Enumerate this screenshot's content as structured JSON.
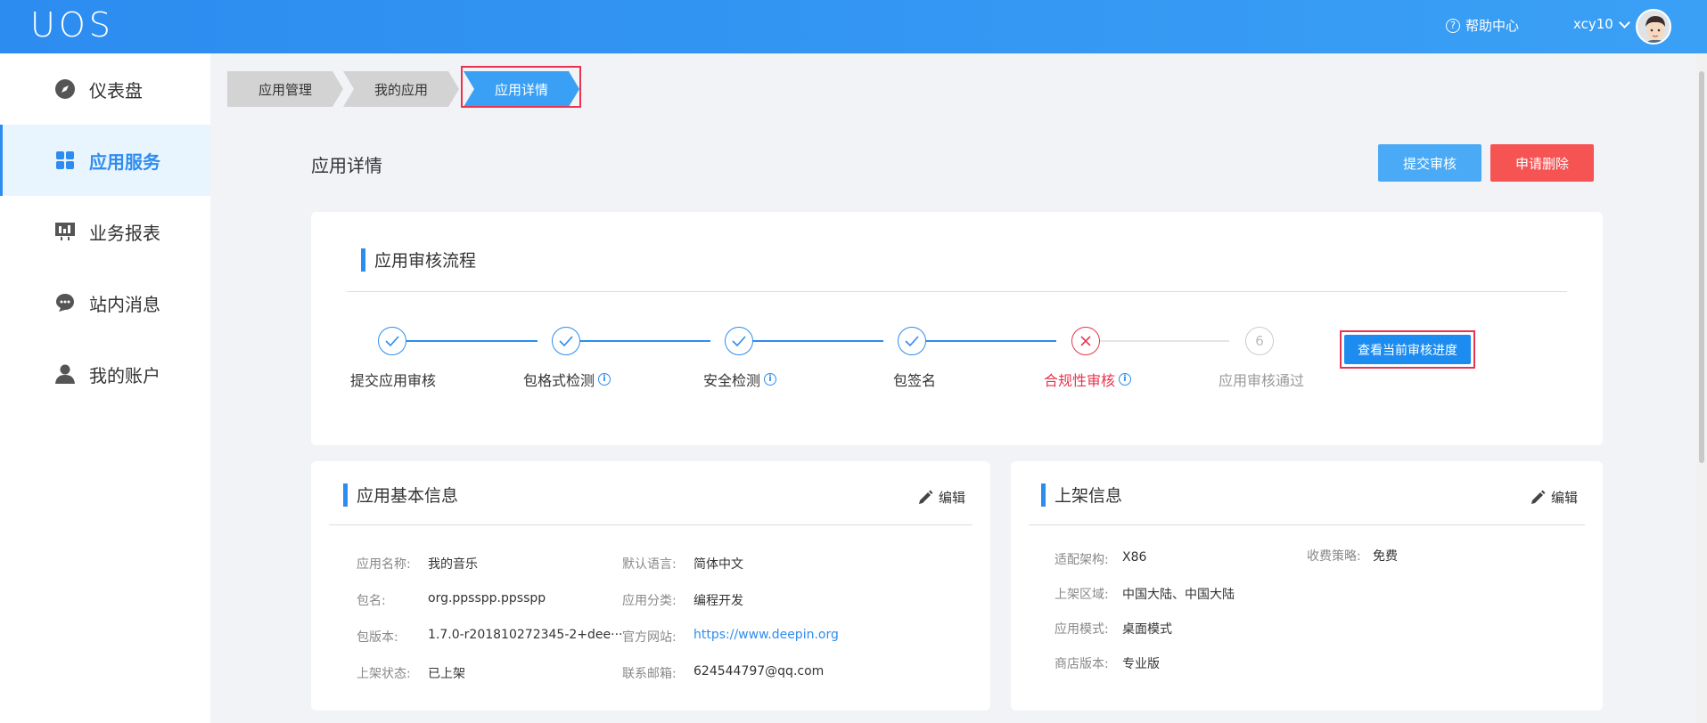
{
  "header": {
    "logo": "UOS",
    "help_label": "帮助中心",
    "username": "xcy10"
  },
  "sidebar": {
    "items": [
      {
        "label": "仪表盘",
        "icon": "compass-icon"
      },
      {
        "label": "应用服务",
        "icon": "grid-icon",
        "active": true
      },
      {
        "label": "业务报表",
        "icon": "report-icon"
      },
      {
        "label": "站内消息",
        "icon": "message-icon"
      },
      {
        "label": "我的账户",
        "icon": "user-icon"
      }
    ]
  },
  "breadcrumb": [
    "应用管理",
    "我的应用",
    "应用详情"
  ],
  "page": {
    "title": "应用详情",
    "submit_label": "提交审核",
    "delete_label": "申请删除"
  },
  "flow": {
    "title": "应用审核流程",
    "steps": [
      {
        "label": "提交应用审核",
        "status": "done"
      },
      {
        "label": "包格式检测",
        "status": "done",
        "info": true
      },
      {
        "label": "安全检测",
        "status": "done",
        "info": true
      },
      {
        "label": "包签名",
        "status": "done"
      },
      {
        "label": "合规性审核",
        "status": "fail",
        "info": true
      },
      {
        "label": "应用审核通过",
        "status": "todo",
        "number": "6"
      }
    ],
    "progress_label": "查看当前审核进度"
  },
  "basic": {
    "title": "应用基本信息",
    "edit_label": "编辑",
    "left": [
      {
        "k": "应用名称:",
        "v": "我的音乐"
      },
      {
        "k": "包名:",
        "v": "org.ppsspp.ppsspp"
      },
      {
        "k": "包版本:",
        "v": "1.7.0-r201810272345-2+dee···"
      },
      {
        "k": "上架状态:",
        "v": "已上架"
      }
    ],
    "right": [
      {
        "k": "默认语言:",
        "v": "简体中文"
      },
      {
        "k": "应用分类:",
        "v": "编程开发"
      },
      {
        "k": "官方网站:",
        "v": "https://www.deepin.org"
      },
      {
        "k": "联系邮箱:",
        "v": "624544797@qq.com"
      }
    ]
  },
  "shelf": {
    "title": "上架信息",
    "edit_label": "编辑",
    "left": [
      {
        "k": "适配架构:",
        "v": "X86"
      },
      {
        "k": "上架区域:",
        "v": "中国大陆、中国大陆"
      },
      {
        "k": "应用模式:",
        "v": "桌面模式"
      },
      {
        "k": "商店版本:",
        "v": "专业版"
      }
    ],
    "right": [
      {
        "k": "收费策略:",
        "v": "免费"
      }
    ]
  },
  "colors": {
    "primary": "#2d8cf0",
    "danger": "#f65353",
    "highlight": "#e8344e"
  }
}
